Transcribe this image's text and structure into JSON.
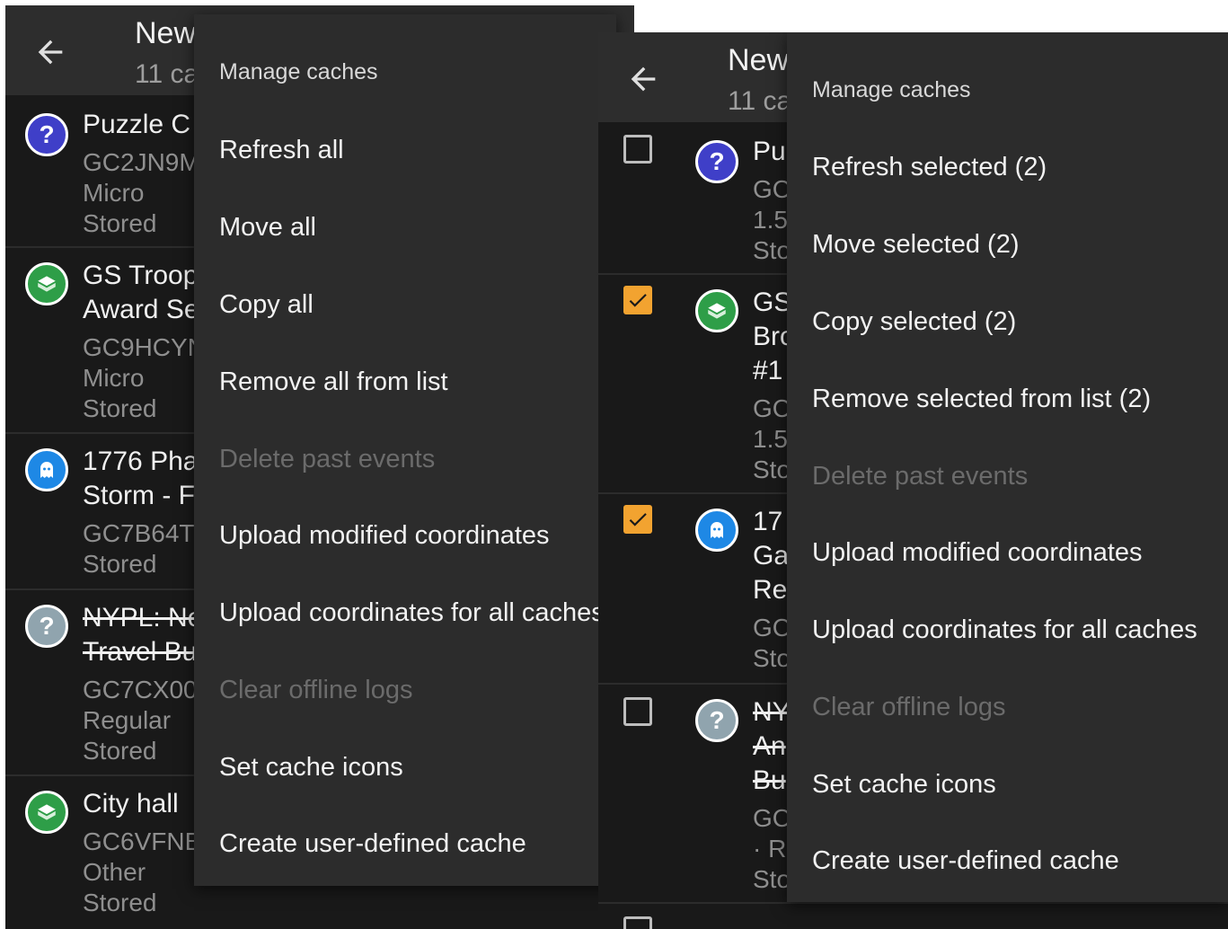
{
  "colors": {
    "accent": "#f2a330",
    "background": "#1e1e1e",
    "toolbar": "#2d2d2d",
    "menu": "#2c2c2c"
  },
  "left_panel": {
    "toolbar": {
      "title": "New",
      "subtitle": "11 ca",
      "back_icon": "arrow-left-icon"
    },
    "caches": [
      {
        "icon": "question-mark-icon",
        "name": [
          "Puzzle C"
        ],
        "meta": [
          "GC2JN9M",
          "Micro",
          "Stored"
        ]
      },
      {
        "icon": "box-icon",
        "name": [
          "GS Troop",
          "Award Se"
        ],
        "meta": [
          "GC9HCYN",
          "Micro",
          "Stored"
        ]
      },
      {
        "icon": "ghost-icon",
        "name": [
          "1776 Pha",
          "Storm - F"
        ],
        "meta": [
          "GC7B64T",
          "Stored"
        ]
      },
      {
        "icon": "question-mark-icon",
        "name": [
          "NYPL: Ne",
          "Travel Bu"
        ],
        "meta": [
          "GC7CX00",
          "Regular",
          "Stored"
        ]
      },
      {
        "icon": "box-icon",
        "name": [
          "City hall"
        ],
        "meta": [
          "GC6VFNB",
          "Other",
          "Stored"
        ]
      }
    ],
    "menu": {
      "header": "Manage caches",
      "items": [
        {
          "label": "Refresh all",
          "enabled": true
        },
        {
          "label": "Move all",
          "enabled": true
        },
        {
          "label": "Copy all",
          "enabled": true
        },
        {
          "label": "Remove all from list",
          "enabled": true
        },
        {
          "label": "Delete past events",
          "enabled": false
        },
        {
          "label": "Upload modified coordinates",
          "enabled": true
        },
        {
          "label": "Upload coordinates for all caches",
          "enabled": true
        },
        {
          "label": "Clear offline logs",
          "enabled": false
        },
        {
          "label": "Set cache icons",
          "enabled": true
        },
        {
          "label": "Create user-defined cache",
          "enabled": true
        }
      ]
    }
  },
  "right_panel": {
    "toolbar": {
      "title": "New",
      "subtitle": "11 ca",
      "back_icon": "arrow-left-icon"
    },
    "caches": [
      {
        "checked": false,
        "icon": "question-mark-icon",
        "name": [
          "Pu"
        ],
        "meta": [
          "GC",
          "1.5",
          "Sto"
        ]
      },
      {
        "checked": true,
        "icon": "box-icon",
        "name": [
          "GS",
          "Bro",
          "#1"
        ],
        "meta": [
          "GC",
          "1.5",
          "Sto"
        ]
      },
      {
        "checked": true,
        "icon": "ghost-icon",
        "name": [
          "17",
          "Ga",
          "Re"
        ],
        "meta": [
          "GC",
          "Sto"
        ]
      },
      {
        "checked": false,
        "icon": "question-mark-icon",
        "name": [
          "NY",
          "An",
          "Bu"
        ],
        "meta": [
          "GC",
          "· Re",
          "Sto"
        ]
      }
    ],
    "menu": {
      "header": "Manage caches",
      "items": [
        {
          "label": "Refresh selected (2)",
          "enabled": true
        },
        {
          "label": "Move selected (2)",
          "enabled": true
        },
        {
          "label": "Copy selected (2)",
          "enabled": true
        },
        {
          "label": "Remove selected from list (2)",
          "enabled": true
        },
        {
          "label": "Delete past events",
          "enabled": false
        },
        {
          "label": "Upload modified coordinates",
          "enabled": true
        },
        {
          "label": "Upload coordinates for all caches",
          "enabled": true
        },
        {
          "label": "Clear offline logs",
          "enabled": false
        },
        {
          "label": "Set cache icons",
          "enabled": true
        },
        {
          "label": "Create user-defined cache",
          "enabled": true
        }
      ]
    }
  }
}
